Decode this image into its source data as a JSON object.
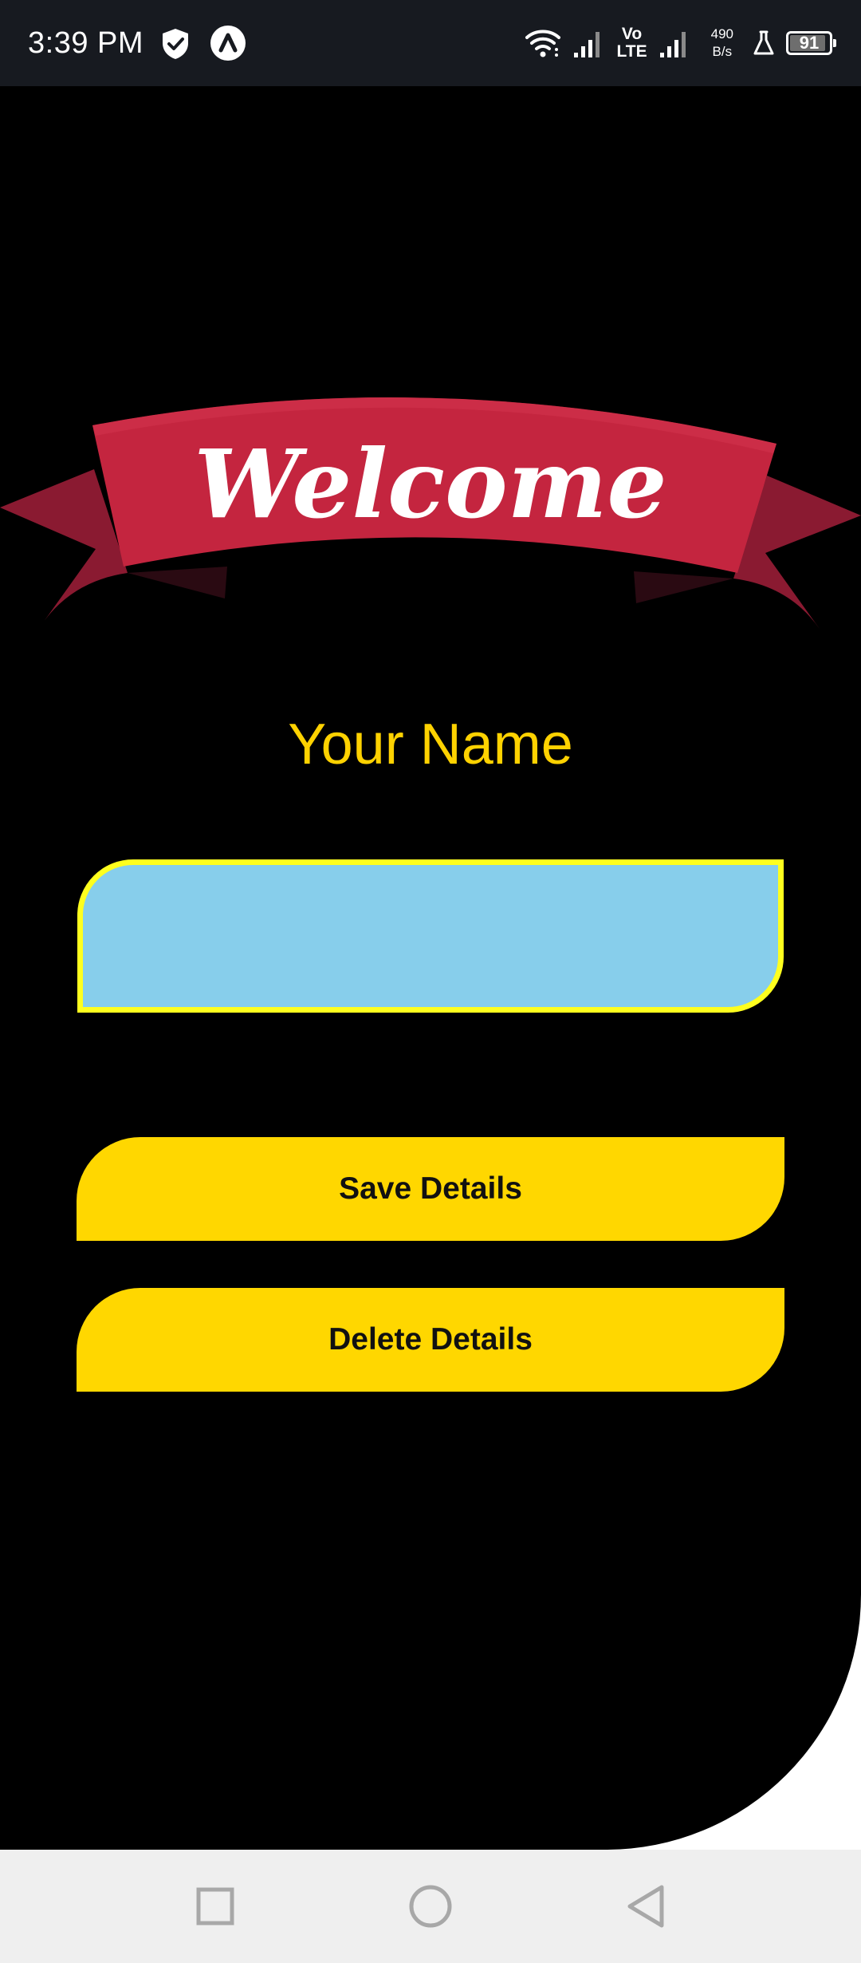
{
  "status_bar": {
    "time": "3:39 PM",
    "volte_top": "Vo",
    "volte_bottom": "LTE",
    "net_speed_value": "490",
    "net_speed_unit": "B/s",
    "battery_level": "91",
    "battery_fraction": 0.91,
    "icons": {
      "left": [
        "shield-check-icon",
        "app-notification-icon"
      ],
      "right": [
        "wifi-icon",
        "signal-1-icon",
        "signal-2-icon",
        "flask-icon",
        "battery-icon"
      ]
    }
  },
  "banner": {
    "text": "Welcome",
    "ribbon_color": "#c4253f",
    "ribbon_dark_color": "#8a1a31"
  },
  "form": {
    "title": "Your Name",
    "name_value": "",
    "name_placeholder": "",
    "save_label": "Save Details",
    "delete_label": "Delete Details"
  },
  "colors": {
    "background": "#000000",
    "title": "#ffd200",
    "input_fill": "#87ceeb",
    "input_border": "#ffff1e",
    "button_fill": "#ffd700",
    "button_text": "#111111",
    "status_bar": "#171a20",
    "nav_bar": "#efefef"
  },
  "nav_bar": {
    "icons": [
      "square-icon",
      "circle-icon",
      "back-triangle-icon"
    ]
  }
}
